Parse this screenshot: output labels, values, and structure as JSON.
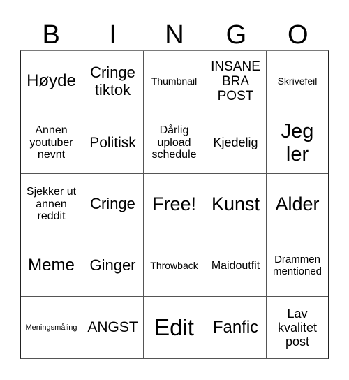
{
  "title_letters": [
    "B",
    "I",
    "N",
    "G",
    "O"
  ],
  "cells": [
    "Høyde",
    "Cringe tiktok",
    "Thumbnail",
    "INSANE BRA POST",
    "Skrivefeil",
    "Annen youtuber nevnt",
    "Politisk",
    "Dårlig upload schedule",
    "Kjedelig",
    "Jeg ler",
    "Sjekker ut annen reddit",
    "Cringe",
    "Free!",
    "Kunst",
    "Alder",
    "Meme",
    "Ginger",
    "Throwback",
    "Maidoutfit",
    "Drammen mentioned",
    "Meningsmåling",
    "ANGST",
    "Edit",
    "Fanfic",
    "Lav kvalitet post"
  ],
  "free_space": "Free!"
}
